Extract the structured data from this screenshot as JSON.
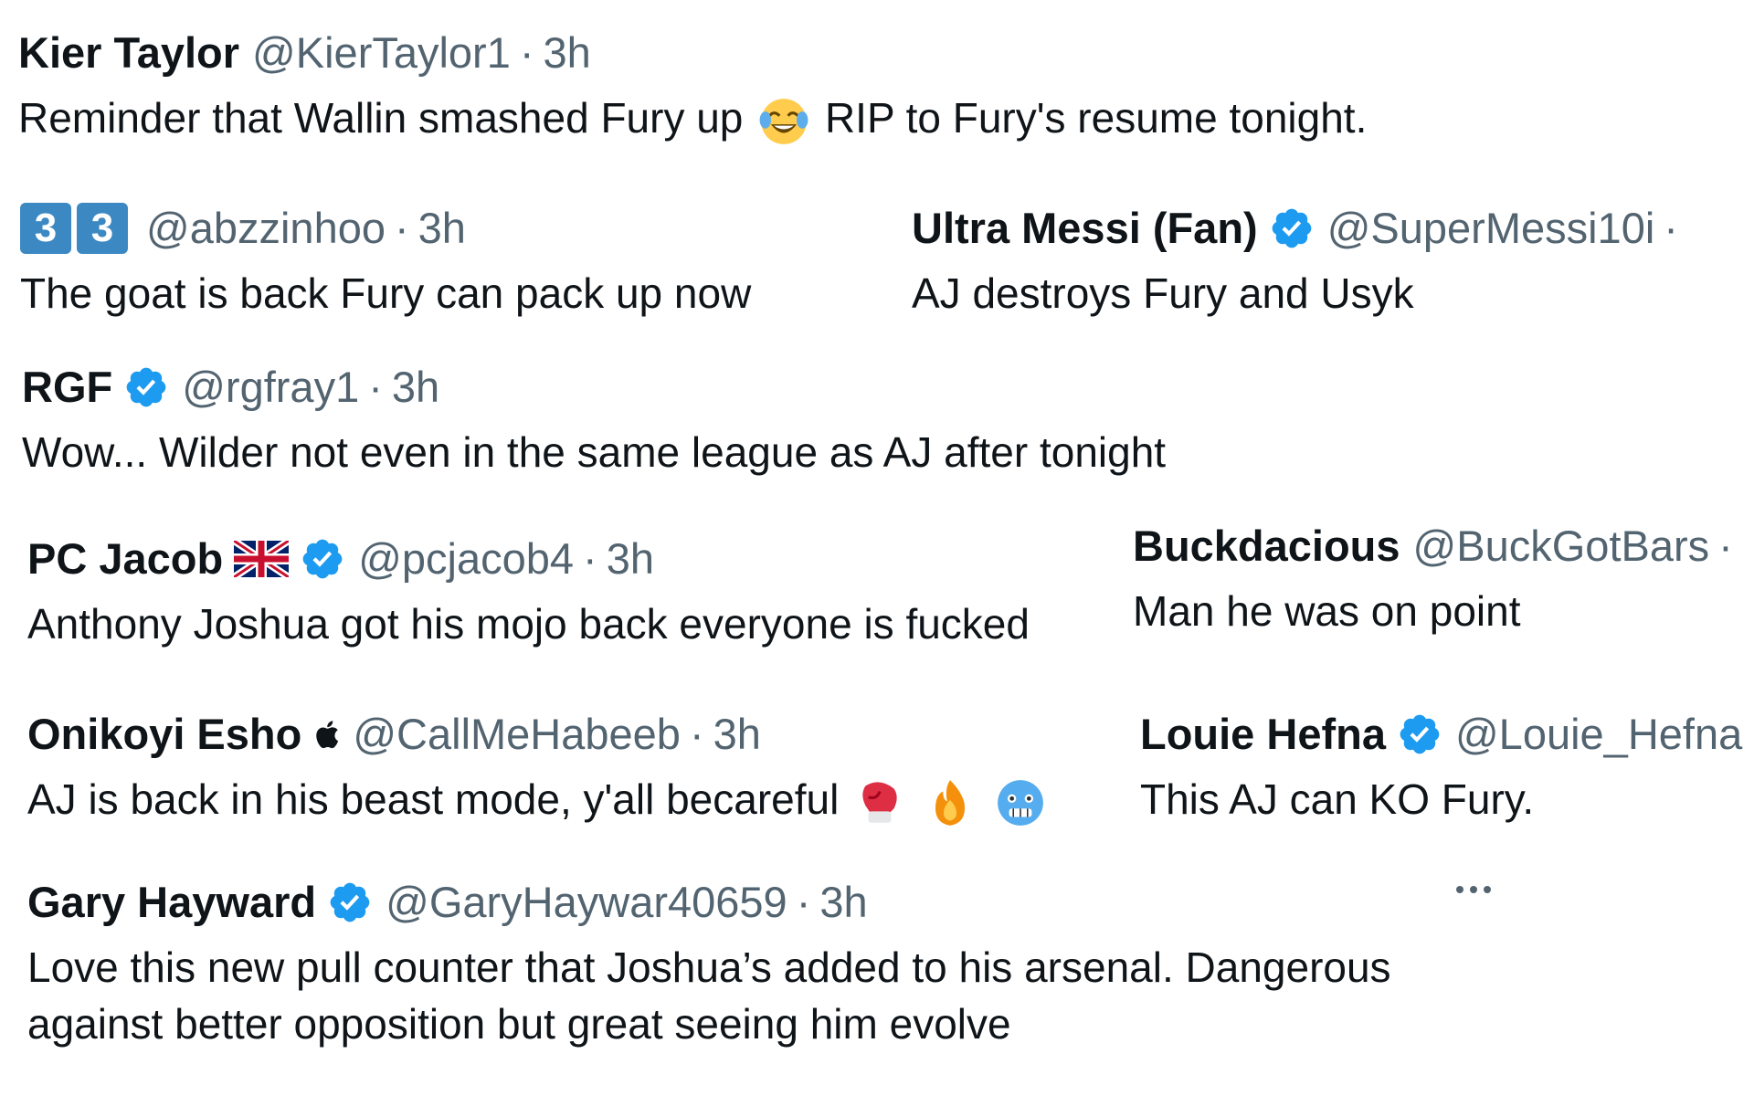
{
  "colors": {
    "text": "#0f1419",
    "muted": "#536471",
    "verified": "#1d9bf0",
    "keycap": "#3b88c3"
  },
  "tweets": [
    {
      "name": "Kier Taylor",
      "handle": "@KierTaylor1",
      "sep": "·",
      "time": "3h",
      "text_before": "Reminder that Wallin smashed Fury up",
      "emoji": "face-with-tears-of-joy",
      "text_after": "RIP to Fury's resume tonight."
    },
    {
      "name_keycaps": [
        "3",
        "3"
      ],
      "handle": "@abzzinhoo",
      "sep": "·",
      "time": "3h",
      "text": "The goat is back Fury can pack up now"
    },
    {
      "name": "Ultra Messi (Fan)",
      "verified": true,
      "handle": "@SuperMessi10i",
      "sep": "·",
      "text": "AJ destroys Fury and Usyk"
    },
    {
      "name": "RGF",
      "verified": true,
      "handle": "@rgfray1",
      "sep": "·",
      "time": "3h",
      "text": "Wow... Wilder not even in the same league as AJ after tonight"
    },
    {
      "name": "PC Jacob",
      "flag": "uk-flag",
      "verified": true,
      "handle": "@pcjacob4",
      "sep": "·",
      "time": "3h",
      "text": "Anthony Joshua got his mojo back everyone is fucked"
    },
    {
      "name": "Buckdacious",
      "handle": "@BuckGotBars",
      "sep": "·",
      "text": "Man he was on point"
    },
    {
      "name": "Onikoyi Esho",
      "apple": true,
      "handle": "@CallMeHabeeb",
      "sep": "·",
      "time": "3h",
      "text": "AJ is back in his beast mode, y'all becareful",
      "emojis": [
        "boxing-glove",
        "fire",
        "cold-face"
      ]
    },
    {
      "name": "Louie Hefna",
      "verified": true,
      "handle": "@Louie_Hefna",
      "sep": "·",
      "text": "This AJ can KO Fury."
    },
    {
      "name": "Gary Hayward",
      "verified": true,
      "handle": "@GaryHaywar40659",
      "sep": "·",
      "time": "3h",
      "text": "Love this new pull counter that Joshua’s added to his arsenal. Dangerous against better opposition but great seeing him evolve",
      "more": "more-options-icon"
    }
  ]
}
